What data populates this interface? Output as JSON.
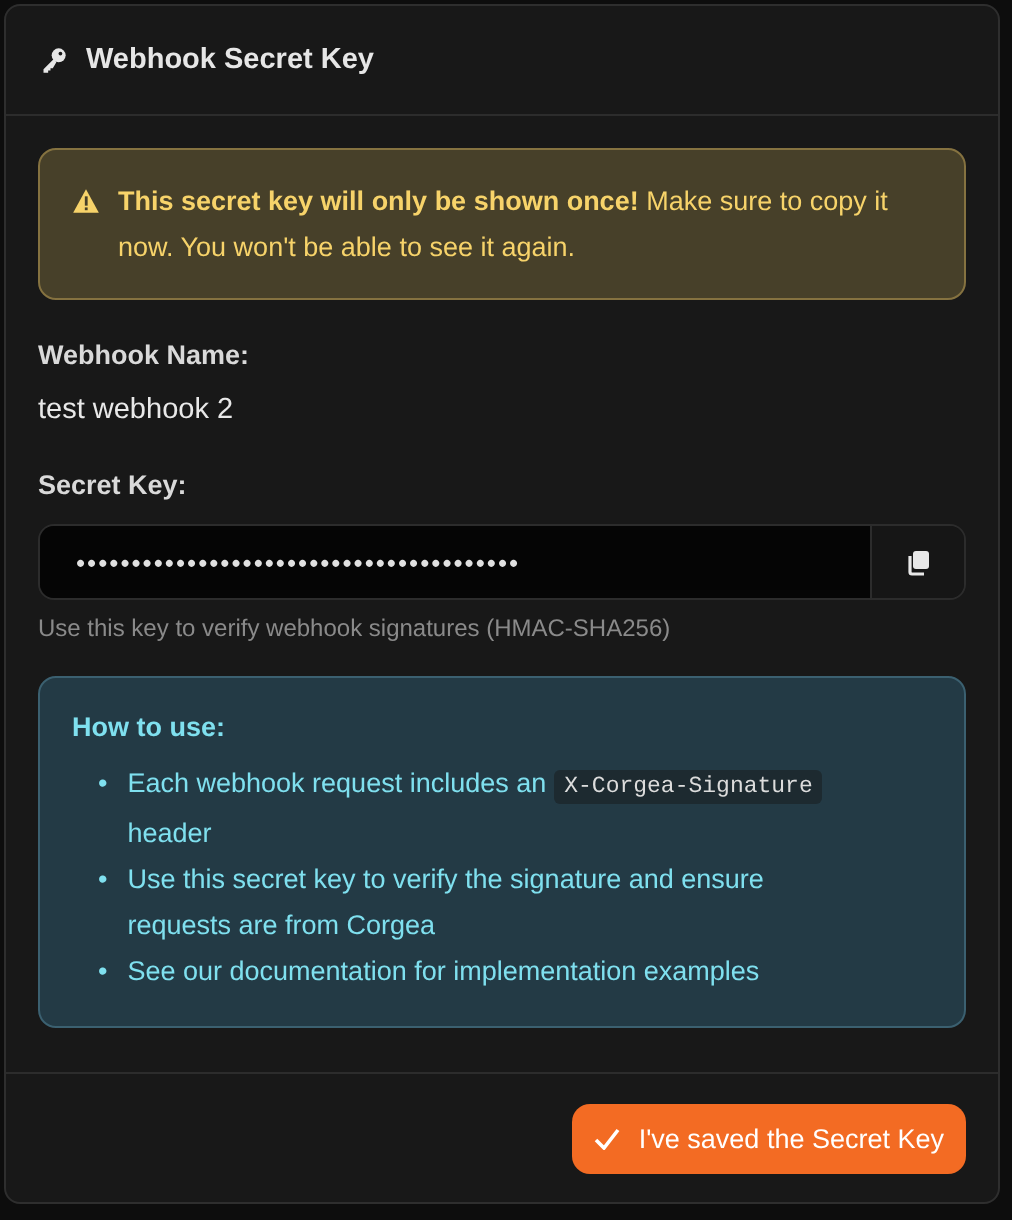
{
  "dialog": {
    "title": "Webhook Secret Key"
  },
  "warning": {
    "text": "**This secret key will only be shown once!** Make sure to copy it now. You won't be able to see it again."
  },
  "webhook_name": {
    "label": "Webhook Name:",
    "value": "test webhook 2"
  },
  "secret_key": {
    "label": "Secret Key:",
    "value": "••••••••••••••••••••••••••••••••••••••••",
    "hint": "Use this key to verify webhook signatures (HMAC-SHA256)"
  },
  "how_to_use": {
    "title": "How to use:",
    "items": [
      {
        "bullet": "•",
        "parts": [
          {
            "kind": "text",
            "text": "Each webhook request includes an"
          },
          {
            "kind": "code",
            "text": "X-Corgea-Signature"
          },
          {
            "kind": "text",
            "text": "header"
          }
        ]
      },
      {
        "bullet": "•",
        "parts": [
          {
            "kind": "text",
            "text": "Use this secret key to verify the signature and ensure requests are from Corgea"
          }
        ]
      },
      {
        "bullet": "•",
        "parts": [
          {
            "kind": "text",
            "text": "See our documentation for implementation examples"
          }
        ]
      }
    ]
  },
  "confirm_button": {
    "label": "I've saved the Secret Key"
  }
}
